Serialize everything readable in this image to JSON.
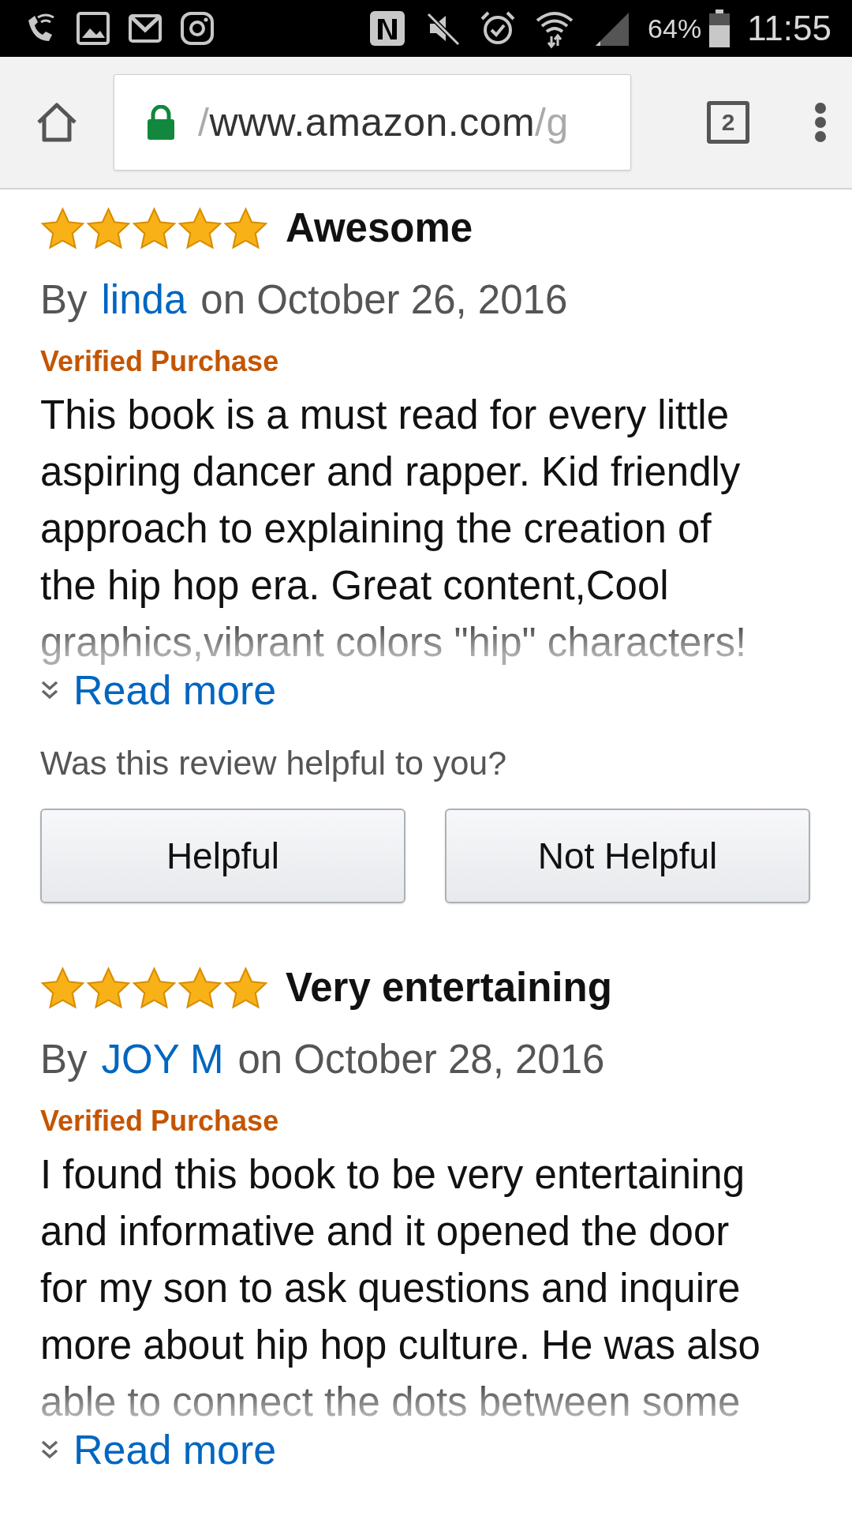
{
  "status_bar": {
    "battery": "64%",
    "time": "11:55"
  },
  "browser": {
    "url_faded_start": "/",
    "url": "www.amazon.com",
    "url_faded_end": "/g",
    "tab_count": "2"
  },
  "reviews": [
    {
      "stars": 5,
      "title": "Awesome",
      "by": "By",
      "author": "linda",
      "date": "on October 26, 2016",
      "badge": "Verified Purchase",
      "body": "This book is a must read for every little aspiring dancer and rapper. Kid friendly approach to explaining the creation of the hip hop era. Great content,Cool graphics,vibrant colors \"hip\" characters!",
      "read_more": "Read more",
      "question": "Was this review helpful to you?",
      "buttons": [
        "Helpful",
        "Not Helpful"
      ]
    },
    {
      "stars": 5,
      "title": "Very entertaining",
      "by": "By",
      "author": "JOY M",
      "date": "on October 28, 2016",
      "badge": "Verified Purchase",
      "body": "I found this book to be very entertaining and informative and it opened the door for my son to ask questions and inquire more about hip hop culture. He was also able to connect the dots between some",
      "read_more": "Read more"
    }
  ]
}
